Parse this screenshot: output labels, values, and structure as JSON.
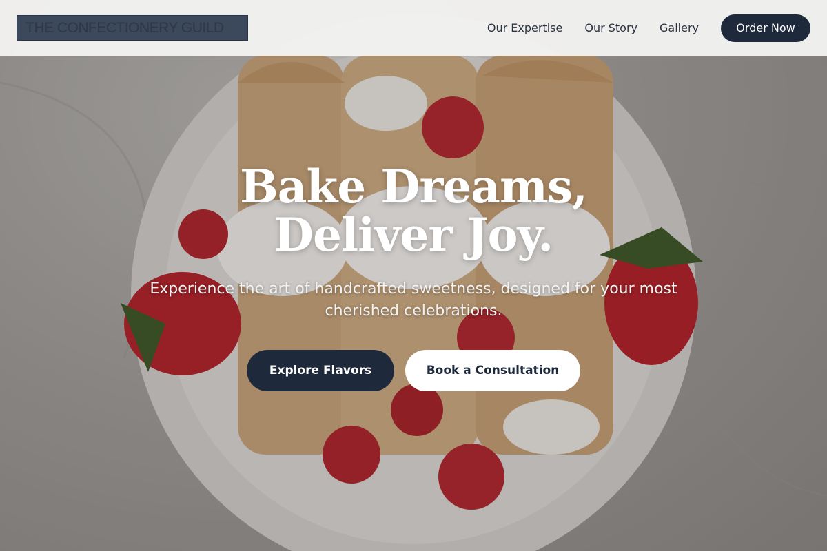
{
  "header": {
    "brand": "THE CONFECTIONERY GUILD",
    "nav": [
      "Our Expertise",
      "Our Story",
      "Gallery"
    ],
    "order_button": "Order Now"
  },
  "hero": {
    "headline_line1": "Bake Dreams,",
    "headline_line2": "Deliver Joy.",
    "subtitle": "Experience the art of handcrafted sweetness, designed for your most cherished celebrations.",
    "primary_cta": "Explore Flavors",
    "secondary_cta": "Book a Consultation",
    "background_image": "crepes-with-whipped-cream-strawberries-raspberries"
  },
  "colors": {
    "accent_dark": "#1e293b",
    "header_bg": "#f3f2f1",
    "text_light": "#ffffff"
  }
}
